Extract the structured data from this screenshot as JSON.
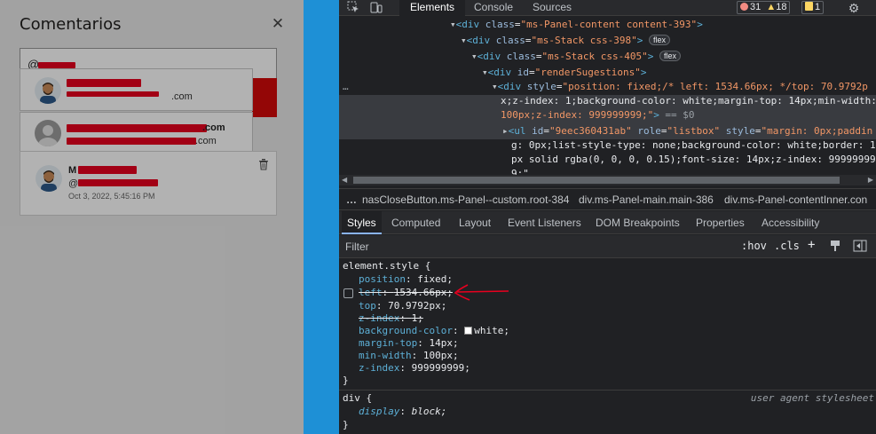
{
  "page": {
    "title": "Comentarios",
    "close_glyph": "✕",
    "mention_text": "@",
    "suggestions": [
      {
        "email_tail": ".com"
      },
      {
        "name_tail": ".com",
        "email_tail": ".com"
      }
    ],
    "comment": {
      "name_prefix": "M",
      "at_prefix": "@",
      "date": "Oct 3, 2022, 5:45:16 PM"
    }
  },
  "devtools": {
    "tabs": [
      "Elements",
      "Console",
      "Sources"
    ],
    "errors": "31",
    "warnings": "18",
    "issues": "1",
    "dom_lines": {
      "l1_tag": "div",
      "l1_attr": "class",
      "l1_val": "\"ms-Panel-content content-393\"",
      "l2_tag": "div",
      "l2_attr": "class",
      "l2_val": "\"ms-Stack css-398\"",
      "l2_pill": "flex",
      "l3_tag": "div",
      "l3_attr": "class",
      "l3_val": "\"ms-Stack css-405\"",
      "l3_pill": "flex",
      "l4_tag": "div",
      "l4_attr": "id",
      "l4_val": "\"renderSugestions\"",
      "sel_ellipsis": "…",
      "sel_a": "style",
      "sel_v1": "\"position: fixed;/* left: 1534.66px; */top: 70.9792p",
      "sel_v2": "x;z-index: 1;background-color: white;margin-top: 14px;min-width:",
      "sel_v3": "100px;z-index: 999999999;\"",
      "sel_eq": " == $0",
      "ul_tag": "ul",
      "ul_a1": "id",
      "ul_v1": "\"9eec360431ab\"",
      "ul_a2": "role",
      "ul_v2": "\"listbox\"",
      "ul_a3": "style",
      "ul_v3": "\"margin: 0px;paddin",
      "ul_c1": "g: 0px;list-style-type: none;background-color: white;border: 1",
      "ul_c2": "px solid rgba(0, 0, 0, 0.15);font-size: 14px;z-index: 99999999",
      "ul_c3": "9;\""
    },
    "breadcrumbs": [
      "…",
      "nasCloseButton.ms-Panel--custom.root-384",
      "div.ms-Panel-main.main-386",
      "div.ms-Panel-contentInner.con"
    ],
    "subtabs": [
      "Styles",
      "Computed",
      "Layout",
      "Event Listeners",
      "DOM Breakpoints",
      "Properties",
      "Accessibility"
    ],
    "filter_placeholder": "Filter",
    "hov": ":hov",
    "cls": ".cls",
    "plus": "+",
    "element_style": {
      "selector": "element.style {",
      "props": [
        {
          "name": "position",
          "value": "fixed;"
        },
        {
          "name": "left",
          "value": "1534.66px;"
        },
        {
          "name": "top",
          "value": "70.9792px;"
        },
        {
          "name": "z-index",
          "value": "1;"
        },
        {
          "name": "background-color",
          "value": "white;"
        },
        {
          "name": "margin-top",
          "value": "14px;"
        },
        {
          "name": "min-width",
          "value": "100px;"
        },
        {
          "name": "z-index",
          "value": "999999999;"
        }
      ],
      "close": "}"
    },
    "ua_rule": {
      "selector": "div {",
      "source": "user agent stylesheet",
      "prop": "display",
      "value": "block;",
      "close": "}"
    },
    "colors": {
      "accent": "#8ab4f8",
      "error": "#e8001f",
      "tag": "#5db0d7",
      "attr_value": "#f29766"
    }
  }
}
